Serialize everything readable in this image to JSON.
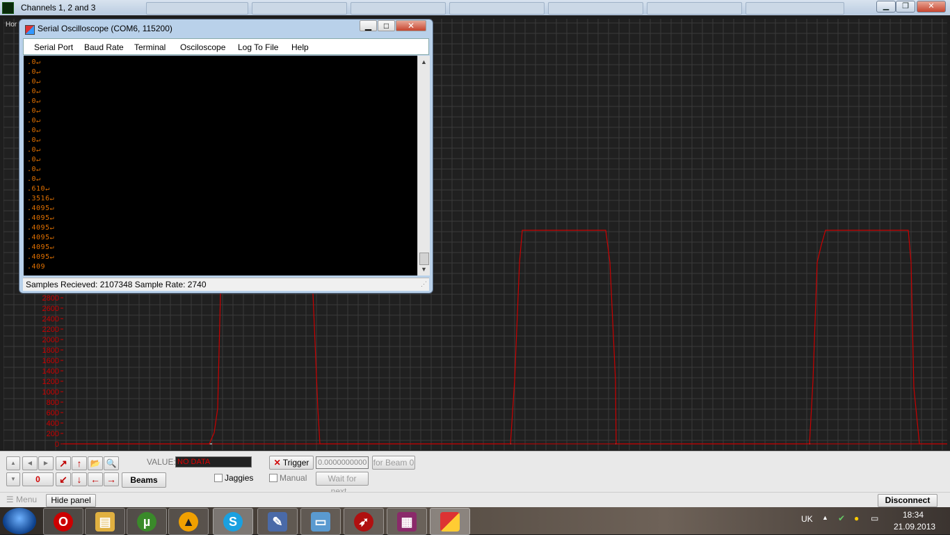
{
  "window_title": "Channels 1, 2 and 3",
  "scope": {
    "hor_label": "Hor",
    "y_axis_labels": [
      "2800",
      "2600",
      "2400",
      "2200",
      "2000",
      "1800",
      "1600",
      "1400",
      "1200",
      "1000",
      "800",
      "600",
      "400",
      "200",
      "0"
    ],
    "trace_color": "#cc0000",
    "grid_color": "#3a3a3a"
  },
  "serial_window": {
    "title": "Serial Oscilloscope (COM6, 115200)",
    "menu": [
      "Serial Port",
      "Baud Rate",
      "Terminal",
      "Osciloscope",
      "Log To File",
      "Help"
    ],
    "terminal_lines": [
      ".0↵",
      ".0↵",
      ".0↵",
      ".0↵",
      ".0↵",
      ".0↵",
      ".0↵",
      ".0↵",
      ".0↵",
      ".0↵",
      ".0↵",
      ".0↵",
      ".0↵",
      ".610↵",
      ".3516↵",
      ".4095↵",
      ".4095↵",
      ".4095↵",
      ".4095↵",
      ".4095↵",
      ".4095↵",
      ".409"
    ],
    "status": "Samples Recieved: 2107348  Sample Rate: 2740"
  },
  "panel": {
    "counter_value": "0",
    "value_label": "VALUE:",
    "value_field": "NO DATA",
    "beams_label": "Beams",
    "jaggies_label": "Jaggies",
    "trigger_label": "Trigger",
    "trigger_value": "0.0000000000",
    "for_beam_label": "for Beam 0",
    "manual_label": "Manual",
    "wait_label": "Wait for next..."
  },
  "bottom_bar": {
    "menu_label": "Menu",
    "hide_panel_label": "Hide panel",
    "disconnect_label": "Disconnect"
  },
  "taskbar": {
    "lang": "UK",
    "time": "18:34",
    "date": "21.09.2013",
    "apps": [
      "opera",
      "file-explorer",
      "utorrent",
      "aimp",
      "skype",
      "paint",
      "picture-viewer",
      "rocket-app",
      "winrar",
      "serial-oscilloscope"
    ]
  }
}
